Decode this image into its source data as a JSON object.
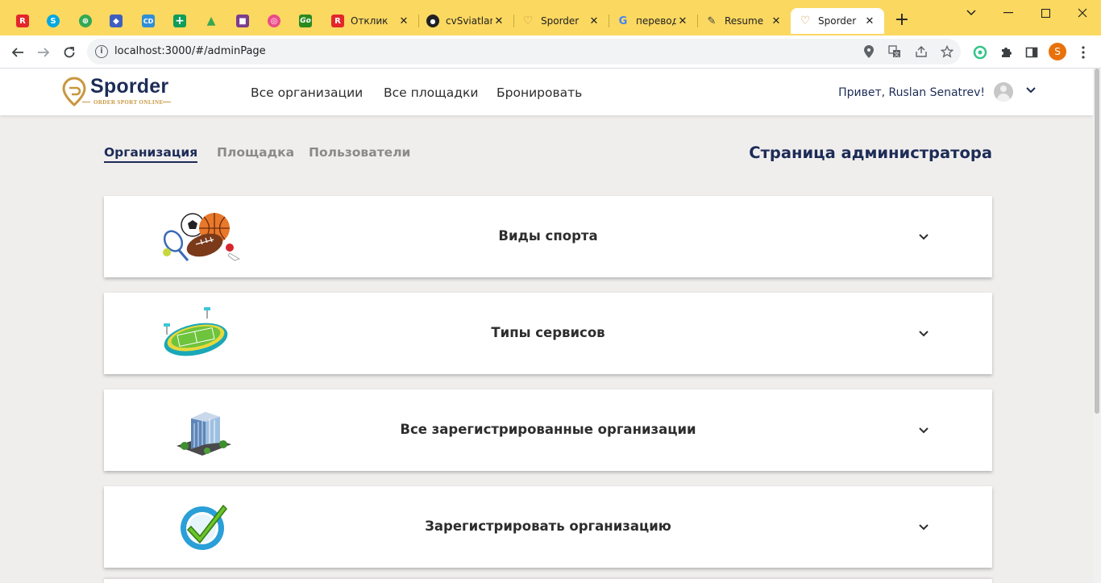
{
  "browser": {
    "pinned_tabs": [
      {
        "icon": "red-r-icon",
        "color": "#e3262b",
        "glyph": "R"
      },
      {
        "icon": "skype-s-icon",
        "color": "#00a8e1",
        "glyph": "S"
      },
      {
        "icon": "green-circle-icon",
        "color": "#33a852",
        "glyph": "⊕"
      },
      {
        "icon": "shield-icon",
        "color": "#3f5fbf",
        "glyph": "◆"
      },
      {
        "icon": "cd-icon",
        "color": "#2f8ed6",
        "glyph": "CD"
      },
      {
        "icon": "sheets-plus-icon",
        "color": "#0f9d58",
        "glyph": "+"
      },
      {
        "icon": "drive-icon",
        "color": "#fbbc04",
        "glyph": "▲"
      },
      {
        "icon": "purple-square-icon",
        "color": "#7a3d8f",
        "glyph": "■"
      },
      {
        "icon": "dribbble-icon",
        "color": "#ea4c89",
        "glyph": "◎"
      },
      {
        "icon": "go-icon",
        "color": "#2a8a1e",
        "glyph": "Go"
      }
    ],
    "tabs": [
      {
        "title": "Отклик",
        "icon": "red-r-icon",
        "color": "#e3262b",
        "glyph": "R"
      },
      {
        "title": "cvSviatlan",
        "icon": "github-icon",
        "color": "#202124",
        "glyph": "●"
      },
      {
        "title": "Sporder",
        "icon": "sporder-icon",
        "color": "#c9963f",
        "glyph": "♡"
      },
      {
        "title": "переводч",
        "icon": "google-icon",
        "color": "#4285f4",
        "glyph": "G"
      },
      {
        "title": "Resume",
        "icon": "doc-edit-icon",
        "color": "#3c4043",
        "glyph": "✎"
      },
      {
        "title": "Sporder",
        "icon": "sporder-icon",
        "color": "#c9963f",
        "glyph": "♡",
        "active": true
      }
    ],
    "url": "localhost:3000/#/adminPage"
  },
  "header": {
    "logo_text": "Sporder",
    "logo_tagline": "ORDER SPORT ONLINE",
    "nav": [
      "Все организации",
      "Все площадки",
      "Бронировать"
    ],
    "greeting": "Привет, Ruslan Senatrev!"
  },
  "subnav": {
    "items": [
      "Организация",
      "Площадка",
      "Пользователи"
    ],
    "active": "Организация"
  },
  "admin_title": "Страница администратора",
  "cards": [
    {
      "label": "Виды спорта",
      "icon": "sports-balls-icon"
    },
    {
      "label": "Типы сервисов",
      "icon": "stadium-icon"
    },
    {
      "label": "Все зарегистрированные организации",
      "icon": "office-building-icon"
    },
    {
      "label": "Зарегистрировать организацию",
      "icon": "checkmark-icon"
    }
  ],
  "colors": {
    "brand_navy": "#1d2c57",
    "brand_gold": "#c9963f",
    "tabstrip": "#fbd860",
    "page_bg": "#f0eeed"
  }
}
